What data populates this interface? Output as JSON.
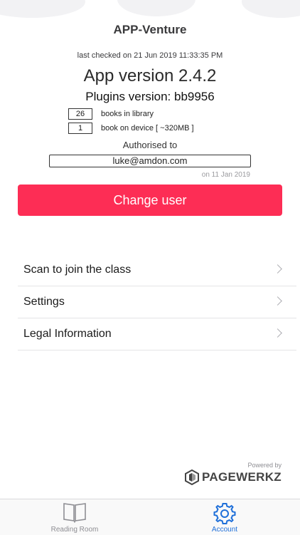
{
  "app": {
    "title": "APP-Venture",
    "last_checked": "last checked on 21 Jun 2019 11:33:35 PM",
    "app_version": "App version 2.4.2",
    "plugins_version": "Plugins version: bb9956"
  },
  "stats": {
    "library_count": "26",
    "library_label": "books in library",
    "device_count": "1",
    "device_label": "book on device [ ~320MB ]"
  },
  "auth": {
    "label": "Authorised to",
    "email": "luke@amdon.com",
    "date": "on 11 Jan 2019",
    "change_user_label": "Change user"
  },
  "menu": {
    "items": [
      {
        "label": "Scan to join the class"
      },
      {
        "label": "Settings"
      },
      {
        "label": "Legal Information"
      }
    ]
  },
  "branding": {
    "powered_by": "Powered by",
    "name": "PAGEWERKZ"
  },
  "tabbar": {
    "tabs": [
      {
        "label": "Reading Room",
        "icon": "book-icon",
        "active": false
      },
      {
        "label": "Account",
        "icon": "gear-icon",
        "active": true
      }
    ]
  },
  "colors": {
    "accent": "#fd2d55",
    "active_tab": "#1e6fd9",
    "inactive_tab": "#8e8e93"
  }
}
